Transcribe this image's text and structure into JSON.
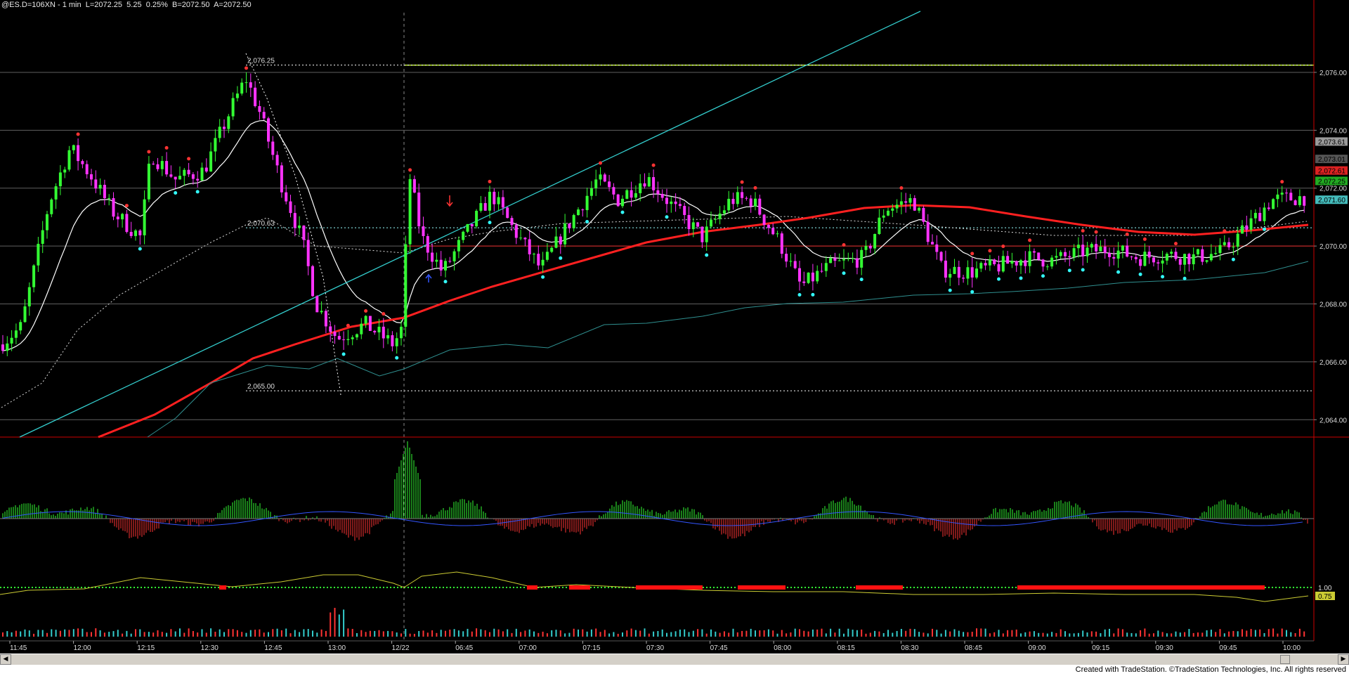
{
  "header": {
    "symbol": "@ES.D=106XN",
    "interval": "1 min",
    "last": "L=2072.25",
    "change": "5.25",
    "change_pct": "0.25%",
    "bid": "B=2072.50",
    "ask": "A=2072.50"
  },
  "footer": {
    "credit": "Created with TradeStation. ©TradeStation Technologies, Inc. All rights reserved"
  },
  "colors": {
    "bull": "#33ff33",
    "bear": "#ff33ff",
    "ema": "#ff2020",
    "avg": "#ffffff",
    "trendline": "#33cccc",
    "grid": "#606060",
    "level_line": "#ccff33"
  },
  "chart_data": {
    "type": "candlestick",
    "price_axis": {
      "ylim": [
        2063.4,
        2078.5
      ],
      "ticks": [
        "2,064.00",
        "2,066.00",
        "2,068.00",
        "2,070.00",
        "2,072.00",
        "2,074.00",
        "2,076.00"
      ],
      "tick_values": [
        2064,
        2066,
        2068,
        2070,
        2072,
        2074,
        2076
      ],
      "markers": [
        {
          "label": "2,073.61",
          "value": 2073.61,
          "color": "#9a9a9a"
        },
        {
          "label": "2,073.01",
          "value": 2073.01,
          "color": "#555555"
        },
        {
          "label": "2,072.61",
          "value": 2072.61,
          "color": "#dd2222"
        },
        {
          "label": "2,072.25",
          "value": 2072.25,
          "color": "#22aa22"
        },
        {
          "label": "2,071.60",
          "value": 2071.6,
          "color": "#44bbbb"
        }
      ]
    },
    "time_axis": {
      "labels": [
        "11:45",
        "12:00",
        "12:15",
        "12:30",
        "12:45",
        "13:00",
        "12/22",
        "06:45",
        "07:00",
        "07:15",
        "07:30",
        "07:45",
        "08:00",
        "08:15",
        "08:30",
        "08:45",
        "09:00",
        "09:15",
        "09:30",
        "09:45",
        "10:00"
      ]
    },
    "annotations": [
      {
        "text": "2,076.25",
        "value": 2076.25
      },
      {
        "text": "2,070.63",
        "value": 2070.63
      },
      {
        "text": "2,065.00",
        "value": 2065.0
      }
    ],
    "histogram_panel": {
      "series": [
        "histogram",
        "signal"
      ]
    },
    "indicator_panel": {
      "ticks": [
        "1.00",
        "0.75"
      ],
      "tick_values": [
        1.0,
        0.75
      ]
    },
    "volume_panel": {
      "series": [
        "volume"
      ]
    }
  }
}
